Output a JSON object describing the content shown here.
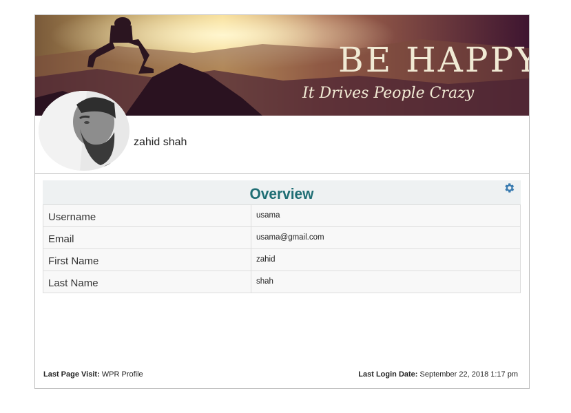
{
  "banner": {
    "headline": "BE HAPPY",
    "tagline": "It Drives People Crazy"
  },
  "profile": {
    "display_name": "zahid shah"
  },
  "overview": {
    "title": "Overview",
    "settings_icon": "gear-icon",
    "rows": [
      {
        "label": "Username",
        "value": "usama"
      },
      {
        "label": "Email",
        "value": "usama@gmail.com"
      },
      {
        "label": "First Name",
        "value": "zahid"
      },
      {
        "label": "Last Name",
        "value": "shah"
      }
    ]
  },
  "footer": {
    "last_page_label": "Last Page Visit:",
    "last_page_value": "WPR Profile",
    "last_login_label": "Last Login Date:",
    "last_login_value": "September 22, 2018 1:17 pm"
  },
  "colors": {
    "title": "#1f6e74",
    "gear": "#3a7bb0",
    "header_bg": "#eef1f2"
  }
}
